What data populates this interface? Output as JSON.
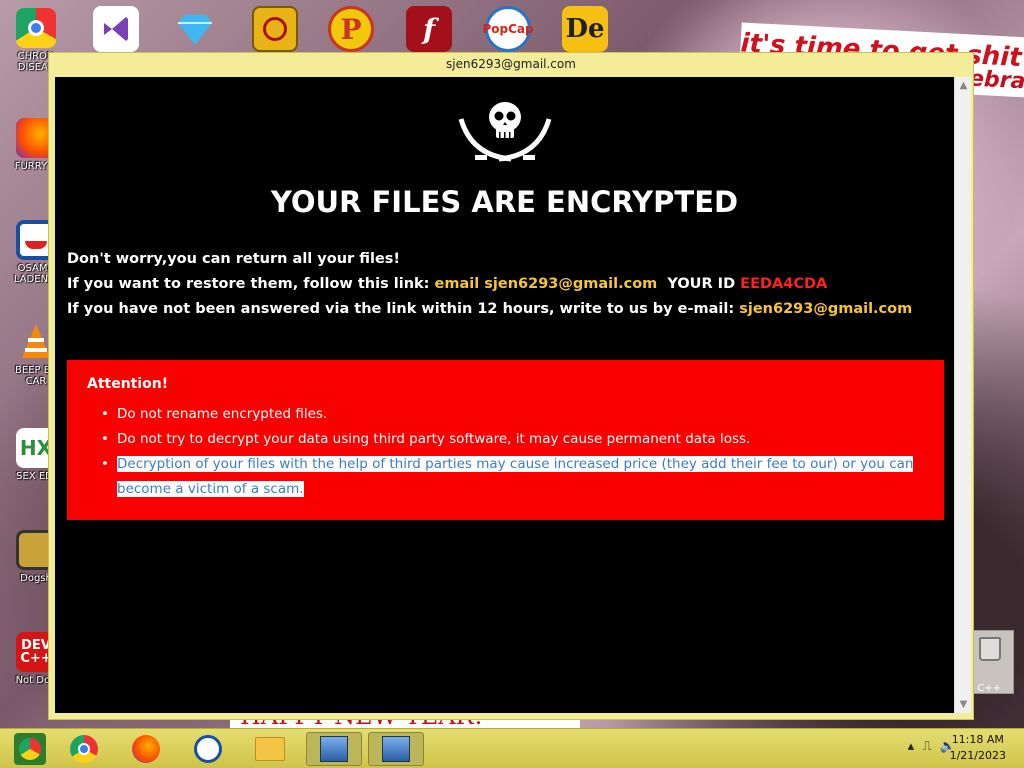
{
  "window": {
    "title": "sjen6293@gmail.com"
  },
  "note": {
    "headline": "YOUR FILES ARE ENCRYPTED",
    "line1": "Don't worry,you can return all your files!",
    "line2_prefix": "If you want to restore them, follow this link:",
    "line2_link": "email sjen6293@gmail.com",
    "line2_id_label": "YOUR ID",
    "line2_id_value": "EEDA4CDA",
    "line3_prefix": "If you have not been answered via the link within 12 hours, write to us by e-mail:",
    "line3_email": "sjen6293@gmail.com",
    "attention_title": "Attention!",
    "bullets": [
      "Do not rename encrypted files.",
      "Do not try to decrypt your data using third party software, it may cause permanent data loss.",
      "Decryption of your files with the help of third parties may cause increased price (they add their fee to our) or you can become a victim of a scam."
    ]
  },
  "desktop_icons": [
    {
      "label": "CHRON DISEAS",
      "icon": "chrome-icon"
    },
    {
      "label": "FURRY C",
      "icon": "firefox-icon"
    },
    {
      "label": "OSAMA LADEN B",
      "icon": "obama-logo-icon"
    },
    {
      "label": "BEEP BE CAR",
      "icon": "vlc-cone-icon"
    },
    {
      "label": "SEX EDI",
      "icon": "hex-editor-icon"
    },
    {
      "label": "Dogsh",
      "icon": "dogecoin-icon"
    },
    {
      "label": "Not Dog",
      "icon": "devcpp-icon"
    }
  ],
  "right_icon_label": "n C++",
  "banner_text": "it's time to get shit",
  "banner_text2": "ebra",
  "bottom_banner_text": "HAPPY NEW YEAR!",
  "taskbar": {
    "time": "11:18 AM",
    "date": "1/21/2023",
    "colors": {
      "bar": "#e6dd72"
    }
  }
}
